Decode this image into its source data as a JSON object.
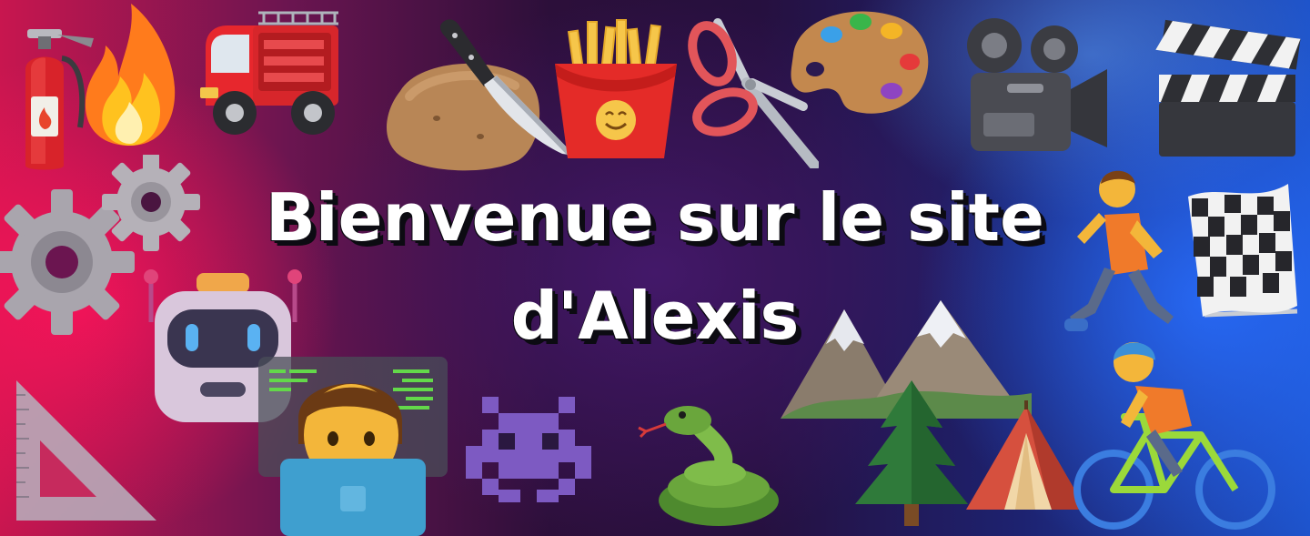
{
  "headline": {
    "line1": "Bienvenue sur le site",
    "line2": "d'Alexis"
  },
  "background": {
    "left_color": "#c8164f",
    "center_color": "#26103f",
    "right_color": "#1d52c9"
  },
  "decorations": [
    "fire-extinguisher-icon",
    "fire-icon",
    "fire-truck-icon",
    "potato-icon",
    "knife-icon",
    "french-fries-icon",
    "scissors-icon",
    "art-palette-icon",
    "movie-camera-icon",
    "clapper-board-icon",
    "gears-icon",
    "robot-icon",
    "technologist-icon",
    "alien-monster-icon",
    "snake-icon",
    "mountains-icon",
    "evergreen-tree-icon",
    "tent-icon",
    "person-running-icon",
    "chequered-flag-icon",
    "person-biking-icon",
    "triangular-ruler-icon"
  ]
}
